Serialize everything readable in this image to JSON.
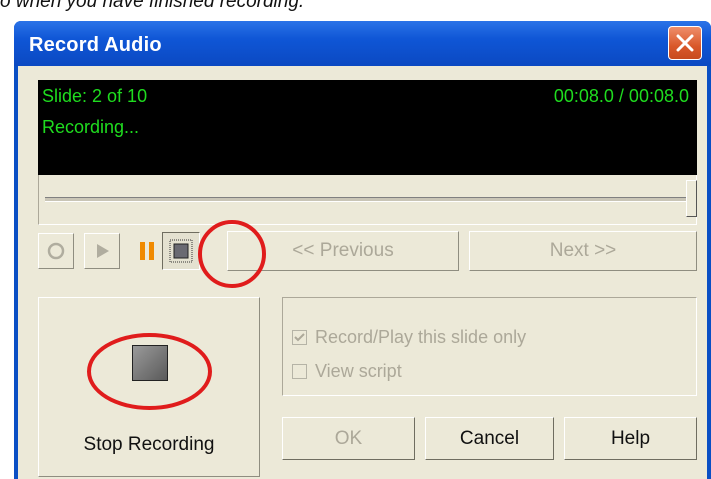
{
  "caption": "o when you have finished recording.",
  "window": {
    "title": "Record Audio"
  },
  "display": {
    "slide_text": "Slide: 2 of 10",
    "time_text": "00:08.0 / 00:08.0",
    "status_text": "Recording...",
    "text_color": "#1fdc1f",
    "background": "#000000"
  },
  "position_slider": {
    "level": 1.0
  },
  "transport": {
    "buttons": [
      {
        "name": "record",
        "icon": "record-circle-icon",
        "enabled": false
      },
      {
        "name": "play",
        "icon": "play-triangle-icon",
        "enabled": false
      },
      {
        "name": "pause",
        "icon": "pause-bars-icon",
        "enabled": true
      },
      {
        "name": "stop",
        "icon": "stop-square-icon",
        "enabled": true,
        "pressed": true
      }
    ],
    "previous_label": "<< Previous",
    "next_label": "Next >>"
  },
  "stop_panel": {
    "label": "Stop Recording",
    "icon": "stop-square-icon"
  },
  "options": {
    "this_slide_only": {
      "label": "Record/Play this slide only",
      "checked": true,
      "enabled": false
    },
    "view_script": {
      "label": "View script",
      "checked": false,
      "enabled": false
    }
  },
  "buttons": {
    "ok": "OK",
    "cancel": "Cancel",
    "help": "Help"
  },
  "colors": {
    "titlebar": "#0b49c2",
    "dialog_face": "#ece9d8",
    "disabled_text": "#aca899",
    "highlight_ring": "#e01c1c",
    "pause_icon": "#f08a00"
  }
}
